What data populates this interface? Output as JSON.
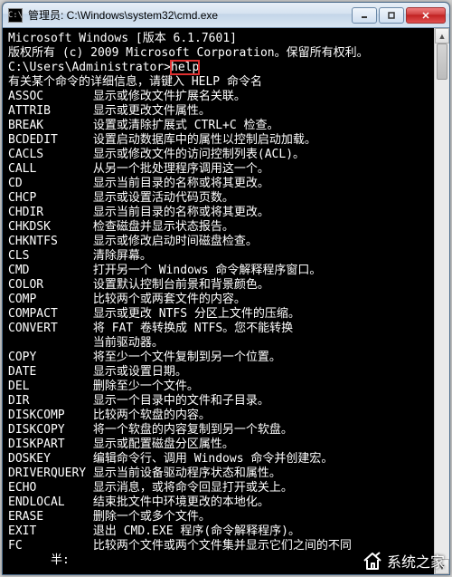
{
  "titlebar": {
    "icon_label": "C:\\",
    "title": "管理员: C:\\Windows\\system32\\cmd.exe"
  },
  "header_lines": [
    "Microsoft Windows [版本 6.1.7601]",
    "版权所有 (c) 2009 Microsoft Corporation。保留所有权利。",
    ""
  ],
  "prompt": "C:\\Users\\Administrator>",
  "command": "help",
  "intro": "有关某个命令的详细信息，请键入 HELP 命令名",
  "commands": [
    {
      "name": "ASSOC",
      "desc": "显示或修改文件扩展名关联。"
    },
    {
      "name": "ATTRIB",
      "desc": "显示或更改文件属性。"
    },
    {
      "name": "BREAK",
      "desc": "设置或清除扩展式 CTRL+C 检查。"
    },
    {
      "name": "BCDEDIT",
      "desc": "设置启动数据库中的属性以控制启动加载。"
    },
    {
      "name": "CACLS",
      "desc": "显示或修改文件的访问控制列表(ACL)。"
    },
    {
      "name": "CALL",
      "desc": "从另一个批处理程序调用这一个。"
    },
    {
      "name": "CD",
      "desc": "显示当前目录的名称或将其更改。"
    },
    {
      "name": "CHCP",
      "desc": "显示或设置活动代码页数。"
    },
    {
      "name": "CHDIR",
      "desc": "显示当前目录的名称或将其更改。"
    },
    {
      "name": "CHKDSK",
      "desc": "检查磁盘并显示状态报告。"
    },
    {
      "name": "CHKNTFS",
      "desc": "显示或修改启动时间磁盘检查。"
    },
    {
      "name": "CLS",
      "desc": "清除屏幕。"
    },
    {
      "name": "CMD",
      "desc": "打开另一个 Windows 命令解释程序窗口。"
    },
    {
      "name": "COLOR",
      "desc": "设置默认控制台前景和背景颜色。"
    },
    {
      "name": "COMP",
      "desc": "比较两个或两套文件的内容。"
    },
    {
      "name": "COMPACT",
      "desc": "显示或更改 NTFS 分区上文件的压缩。"
    },
    {
      "name": "CONVERT",
      "desc": "将 FAT 卷转换成 NTFS。您不能转换"
    },
    {
      "name": "",
      "desc": "当前驱动器。"
    },
    {
      "name": "COPY",
      "desc": "将至少一个文件复制到另一个位置。"
    },
    {
      "name": "DATE",
      "desc": "显示或设置日期。"
    },
    {
      "name": "DEL",
      "desc": "删除至少一个文件。"
    },
    {
      "name": "DIR",
      "desc": "显示一个目录中的文件和子目录。"
    },
    {
      "name": "DISKCOMP",
      "desc": "比较两个软盘的内容。"
    },
    {
      "name": "DISKCOPY",
      "desc": "将一个软盘的内容复制到另一个软盘。"
    },
    {
      "name": "DISKPART",
      "desc": "显示或配置磁盘分区属性。"
    },
    {
      "name": "DOSKEY",
      "desc": "编辑命令行、调用 Windows 命令并创建宏。"
    },
    {
      "name": "DRIVERQUERY",
      "desc": "显示当前设备驱动程序状态和属性。"
    },
    {
      "name": "ECHO",
      "desc": "显示消息，或将命令回显打开或关上。"
    },
    {
      "name": "ENDLOCAL",
      "desc": "结束批文件中环境更改的本地化。"
    },
    {
      "name": "ERASE",
      "desc": "删除一个或多个文件。"
    },
    {
      "name": "EXIT",
      "desc": "退出 CMD.EXE 程序(命令解释程序)。"
    },
    {
      "name": "FC",
      "desc": "比较两个文件或两个文件集并显示它们之间的不同"
    }
  ],
  "tail": "半:",
  "watermark": "系统之家"
}
